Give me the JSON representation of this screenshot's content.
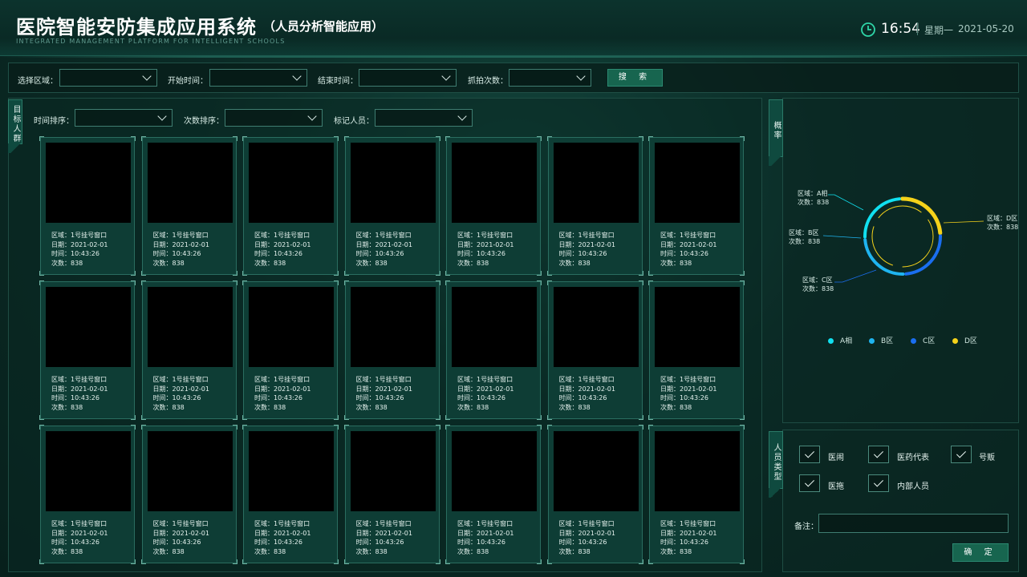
{
  "header": {
    "title": "医院智能安防集成应用系统",
    "subtitle": "（人员分析智能应用）",
    "subtitle_en": "INTEGRATED MANAGEMENT PLATFORM FOR INTELLIGENT SCHOOLS",
    "time": "16:54",
    "weekday": "星期一",
    "date": "2021-05-20"
  },
  "search": {
    "area_label": "选择区域：",
    "start_label": "开始时间：",
    "end_label": "结束时间：",
    "count_label": "抓拍次数：",
    "button": "搜 索"
  },
  "left": {
    "tab": "目标人群",
    "time_sort_label": "时间排序：",
    "count_sort_label": "次数排序：",
    "marked_label": "标记人员："
  },
  "cards": [
    {
      "area": "区域：1号挂号窗口",
      "date": "日期：2021-02-01",
      "time": "时间：10:43:26",
      "count": "次数：838"
    },
    {
      "area": "区域：1号挂号窗口",
      "date": "日期：2021-02-01",
      "time": "时间：10:43:26",
      "count": "次数：838"
    },
    {
      "area": "区域：1号挂号窗口",
      "date": "日期：2021-02-01",
      "time": "时间：10:43:26",
      "count": "次数：838"
    },
    {
      "area": "区域：1号挂号窗口",
      "date": "日期：2021-02-01",
      "time": "时间：10:43:26",
      "count": "次数：838"
    },
    {
      "area": "区域：1号挂号窗口",
      "date": "日期：2021-02-01",
      "time": "时间：10:43:26",
      "count": "次数：838"
    },
    {
      "area": "区域：1号挂号窗口",
      "date": "日期：2021-02-01",
      "time": "时间：10:43:26",
      "count": "次数：838"
    },
    {
      "area": "区域：1号挂号窗口",
      "date": "日期：2021-02-01",
      "time": "时间：10:43:26",
      "count": "次数：838"
    },
    {
      "area": "区域：1号挂号窗口",
      "date": "日期：2021-02-01",
      "time": "时间：10:43:26",
      "count": "次数：838"
    },
    {
      "area": "区域：1号挂号窗口",
      "date": "日期：2021-02-01",
      "time": "时间：10:43:26",
      "count": "次数：838"
    },
    {
      "area": "区域：1号挂号窗口",
      "date": "日期：2021-02-01",
      "time": "时间：10:43:26",
      "count": "次数：838"
    },
    {
      "area": "区域：1号挂号窗口",
      "date": "日期：2021-02-01",
      "time": "时间：10:43:26",
      "count": "次数：838"
    },
    {
      "area": "区域：1号挂号窗口",
      "date": "日期：2021-02-01",
      "time": "时间：10:43:26",
      "count": "次数：838"
    },
    {
      "area": "区域：1号挂号窗口",
      "date": "日期：2021-02-01",
      "time": "时间：10:43:26",
      "count": "次数：838"
    },
    {
      "area": "区域：1号挂号窗口",
      "date": "日期：2021-02-01",
      "time": "时间：10:43:26",
      "count": "次数：838"
    },
    {
      "area": "区域：1号挂号窗口",
      "date": "日期：2021-02-01",
      "time": "时间：10:43:26",
      "count": "次数：838"
    },
    {
      "area": "区域：1号挂号窗口",
      "date": "日期：2021-02-01",
      "time": "时间：10:43:26",
      "count": "次数：838"
    },
    {
      "area": "区域：1号挂号窗口",
      "date": "日期：2021-02-01",
      "time": "时间：10:43:26",
      "count": "次数：838"
    },
    {
      "area": "区域：1号挂号窗口",
      "date": "日期：2021-02-01",
      "time": "时间：10:43:26",
      "count": "次数：838"
    },
    {
      "area": "区域：1号挂号窗口",
      "date": "日期：2021-02-01",
      "time": "时间：10:43:26",
      "count": "次数：838"
    },
    {
      "area": "区域：1号挂号窗口",
      "date": "日期：2021-02-01",
      "time": "时间：10:43:26",
      "count": "次数：838"
    },
    {
      "area": "区域：1号挂号窗口",
      "date": "日期：2021-02-01",
      "time": "时间：10:43:26",
      "count": "次数：838"
    }
  ],
  "rate": {
    "tab": "概率",
    "labels": [
      {
        "area": "区域：A相",
        "count": "次数：838"
      },
      {
        "area": "区域：B区",
        "count": "次数：838"
      },
      {
        "area": "区域：C区",
        "count": "次数：838"
      },
      {
        "area": "区域：D区",
        "count": "次数：838"
      }
    ],
    "legend": [
      {
        "name": "A相",
        "color": "#11e0f0"
      },
      {
        "name": "B区",
        "color": "#1fb4f0"
      },
      {
        "name": "C区",
        "color": "#1a6ef0"
      },
      {
        "name": "D区",
        "color": "#f5d21a"
      }
    ]
  },
  "chart_data": {
    "type": "pie",
    "categories": [
      "A相",
      "B区",
      "C区",
      "D区"
    ],
    "values": [
      838,
      838,
      838,
      838
    ],
    "colors": [
      "#11e0f0",
      "#1fb4f0",
      "#1a6ef0",
      "#f5d21a"
    ],
    "title": "",
    "legend": "bottom"
  },
  "person_type": {
    "tab": "人员类型",
    "options": [
      {
        "label": "医闹",
        "checked": true
      },
      {
        "label": "医药代表",
        "checked": true
      },
      {
        "label": "号贩",
        "checked": true
      },
      {
        "label": "医拖",
        "checked": true
      },
      {
        "label": "内部人员",
        "checked": true
      }
    ],
    "remark_label": "备注：",
    "remark_value": "",
    "confirm": "确 定"
  }
}
